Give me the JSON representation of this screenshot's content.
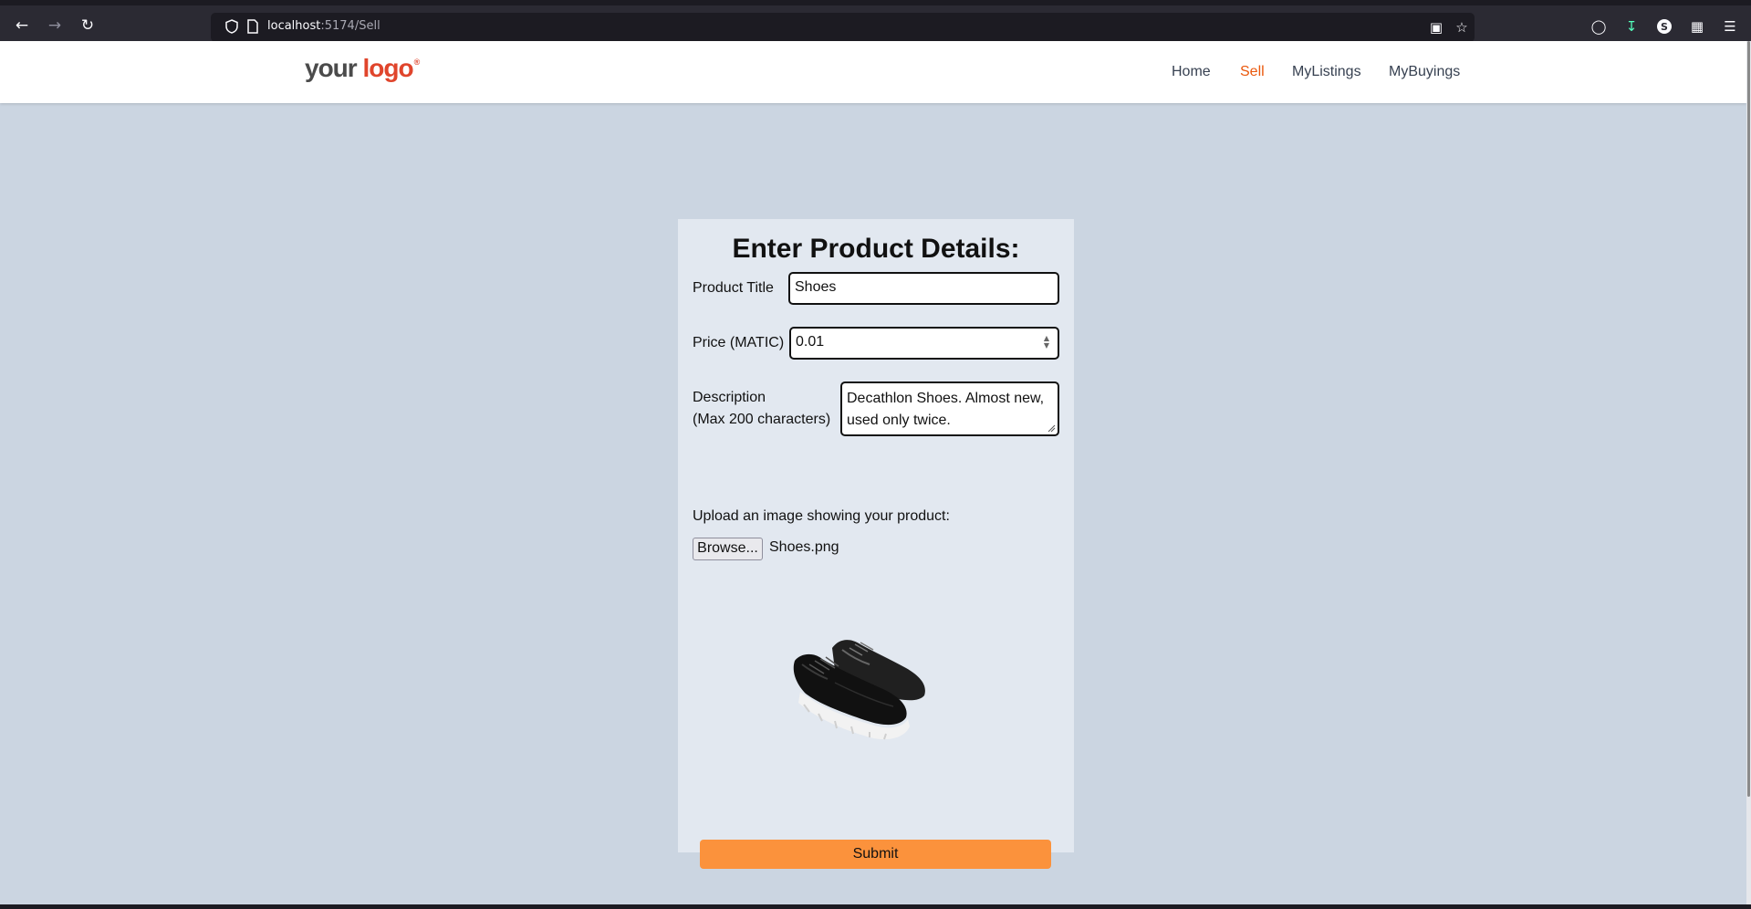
{
  "browser": {
    "url_host": "localhost",
    "url_path": ":5174/Sell",
    "icons": {
      "back": "arrow-left-icon",
      "forward": "arrow-right-icon",
      "reload": "reload-icon",
      "shield": "shield-icon",
      "page": "page-icon",
      "translate": "translate-icon",
      "bookmark": "star-icon",
      "pocket": "pocket-icon",
      "downloads": "download-icon",
      "account": "account-icon",
      "extensions": "puzzle-icon",
      "menu": "hamburger-menu-icon"
    },
    "account_letter": "S"
  },
  "site": {
    "logo": {
      "your": "your",
      "brand": "logo",
      "reg": "®"
    },
    "nav": [
      {
        "label": "Home"
      },
      {
        "label": "Sell",
        "active": true
      },
      {
        "label": "MyListings"
      },
      {
        "label": "MyBuyings"
      }
    ]
  },
  "form": {
    "title": "Enter Product Details:",
    "product_title_label": "Product Title",
    "product_title_value": "Shoes",
    "price_label": "Price (MATIC)",
    "price_value": "0.01",
    "description_label_line1": "Description",
    "description_label_line2": "(Max 200 characters)",
    "description_value": "Decathlon Shoes. Almost new, used only twice.",
    "upload_label": "Upload an image showing your product:",
    "browse_label": "Browse...",
    "file_name": "Shoes.png",
    "submit_label": "Submit"
  },
  "colors": {
    "accent": "#ea580c",
    "submit": "#fb923c",
    "page_bg": "#cbd5e1",
    "card_bg": "#e2e8f0"
  }
}
